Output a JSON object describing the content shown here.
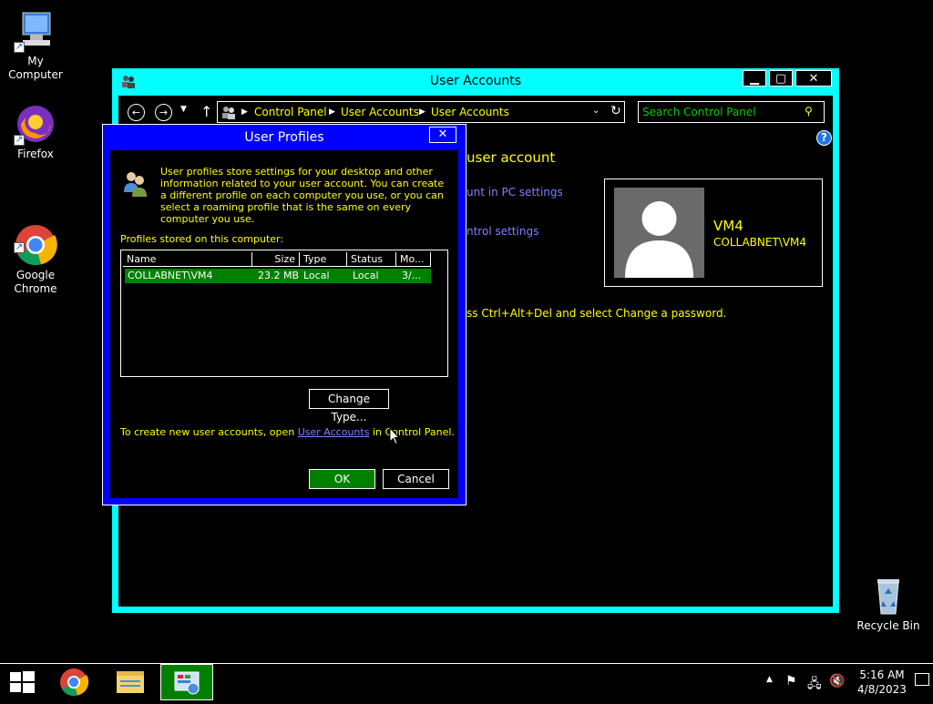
{
  "desktop": {
    "icons": [
      {
        "label": "My Computer"
      },
      {
        "label": "Firefox"
      },
      {
        "label": "Google\nChrome"
      },
      {
        "label": "Recycle Bin"
      }
    ]
  },
  "main_window": {
    "title": "User Accounts",
    "breadcrumbs": [
      "Control Panel",
      "User Accounts",
      "User Accounts"
    ],
    "search_placeholder": "Search Control Panel",
    "heading_partial": "user account",
    "link1_partial": "unt in PC settings",
    "link2_partial": "ntrol settings",
    "password_hint_partial": "ss Ctrl+Alt+Del and select Change a password.",
    "account": {
      "name": "VM4",
      "domain": "COLLABNET\\VM4"
    }
  },
  "dialog": {
    "title": "User Profiles",
    "description": "User profiles store settings for your desktop and other information related to your user account. You can create a different profile on each computer you use, or you can select a roaming profile that is the same on every computer you use.",
    "list_label": "Profiles stored on this computer:",
    "columns": [
      "Name",
      "Size",
      "Type",
      "Status",
      "Mo..."
    ],
    "rows": [
      {
        "name": "COLLABNET\\VM4",
        "size": "23.2 MB",
        "type": "Local",
        "status": "Local",
        "modified": "3/..."
      }
    ],
    "change_type_label": "Change Type...",
    "footer_prefix": "To create new user accounts, open ",
    "footer_link": "User Accounts",
    "footer_suffix": " in Control Panel.",
    "ok_label": "OK",
    "cancel_label": "Cancel",
    "close_glyph": "✕"
  },
  "taskbar": {
    "time": "5:16 AM",
    "date": "4/8/2023"
  }
}
